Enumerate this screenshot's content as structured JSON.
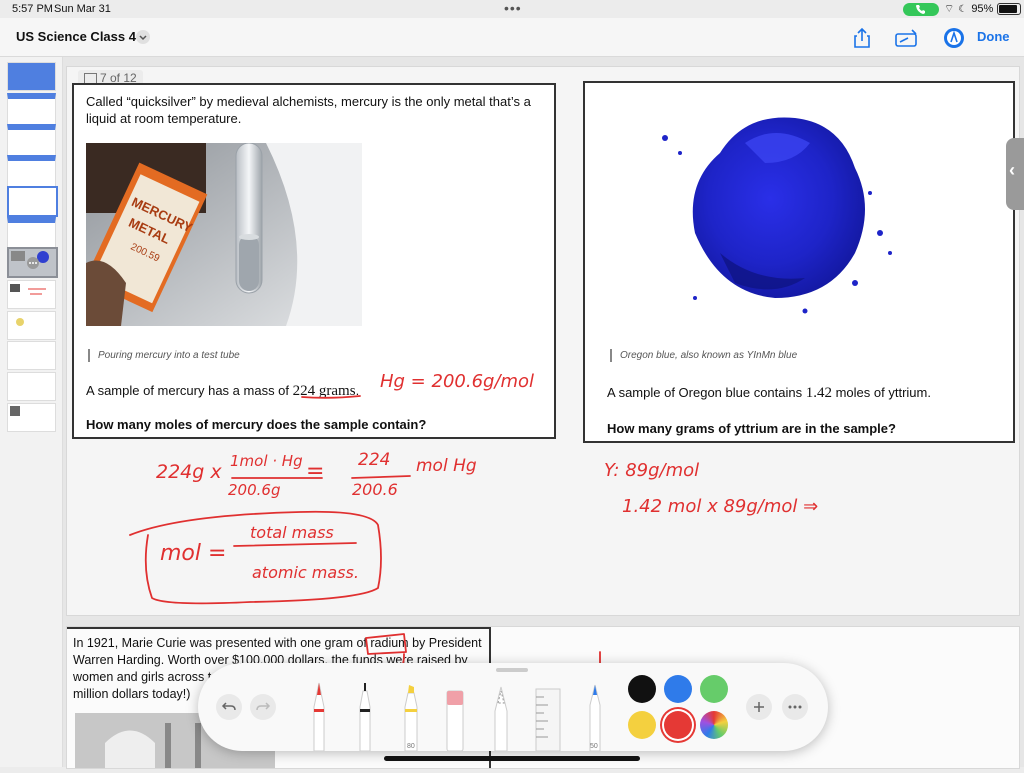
{
  "status": {
    "time": "5:57 PM",
    "date": "Sun Mar 31",
    "battery": "95%"
  },
  "header": {
    "title": "US Science Class 4",
    "done_label": "Done"
  },
  "page_indicator": "7 of 12",
  "card1": {
    "intro": "Called “quicksilver” by medieval alchemists, mercury is the only metal that’s a liquid at room temperature.",
    "caption": "Pouring mercury into a test tube",
    "label_line1": "MERCURY",
    "label_line2": "METAL",
    "label_line3": "200.59",
    "question_pre": "A sample of mercury has a mass of ",
    "question_value": "224 grams",
    "question_post": ".",
    "question_bold": "How many moles of mercury does the sample contain?"
  },
  "card2": {
    "caption": "Oregon blue, also known as YInMn blue",
    "question_pre": "A sample of Oregon blue contains ",
    "question_value": "1.42",
    "question_post": " moles of yttrium.",
    "question_bold": "How many grams of yttrium are in the sample?"
  },
  "handwriting": {
    "hg_note": "Hg = 200.6g/mol",
    "calc_left": "224g x",
    "frac1_num": "1mol · Hg",
    "frac1_den": "200.6g",
    "equals": "=",
    "frac2_num": "224",
    "frac2_den": "200.6",
    "unit": "mol Hg",
    "formula_lhs": "mol =",
    "formula_num": "total mass",
    "formula_den": "atomic mass.",
    "y_note": "Y: 89g/mol",
    "y_calc": "1.42 mol x 89g/mol ⇒"
  },
  "slide2": {
    "text_a": "In 1921, Marie Curie was presented with one gram of ",
    "text_word": "radium",
    "text_b": " by President Warren Harding. Worth over $100,000 dollars, the funds were raised by women and girls across t",
    "text_c": "million dollars today!)"
  },
  "toolbar": {
    "colors": [
      "#111111",
      "#2f7bea",
      "#66cc6a",
      "#f4d03f",
      "#e53935",
      "multi"
    ],
    "selected_color": "#e53935",
    "marker_size": "80",
    "pencil_size": "50"
  }
}
